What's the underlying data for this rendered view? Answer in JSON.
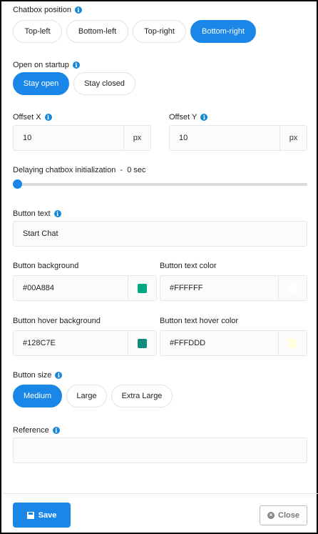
{
  "chatbox_position": {
    "label": "Chatbox position",
    "options": [
      "Top-left",
      "Bottom-left",
      "Top-right",
      "Bottom-right"
    ],
    "selected": "Bottom-right"
  },
  "open_on_startup": {
    "label": "Open on startup",
    "options": [
      "Stay open",
      "Stay closed"
    ],
    "selected": "Stay open"
  },
  "offset_x": {
    "label": "Offset X",
    "value": "10",
    "unit": "px"
  },
  "offset_y": {
    "label": "Offset Y",
    "value": "10",
    "unit": "px"
  },
  "delay": {
    "label": "Delaying chatbox initialization  -  0 sec",
    "value": 0
  },
  "button_text": {
    "label": "Button text",
    "value": "Start Chat"
  },
  "button_background": {
    "label": "Button background",
    "value": "#00A884",
    "swatch": "#00A884"
  },
  "button_text_color": {
    "label": "Button text color",
    "value": "#FFFFFF",
    "swatch": "#FFFFFF"
  },
  "button_hover_background": {
    "label": "Button hover background",
    "value": "#128C7E",
    "swatch": "#128C7E"
  },
  "button_text_hover_color": {
    "label": "Button text hover color",
    "value": "#FFFDDD",
    "swatch": "#FFFDDD"
  },
  "button_size": {
    "label": "Button size",
    "options": [
      "Medium",
      "Large",
      "Extra Large"
    ],
    "selected": "Medium"
  },
  "reference": {
    "label": "Reference",
    "value": ""
  },
  "footer": {
    "save_label": "Save",
    "close_label": "Close"
  },
  "colors": {
    "accent": "#1A87E8",
    "info": "#1A87D6"
  },
  "icons": {
    "info": "info-icon",
    "save": "floppy-disk-icon",
    "close": "close-circle-icon"
  }
}
